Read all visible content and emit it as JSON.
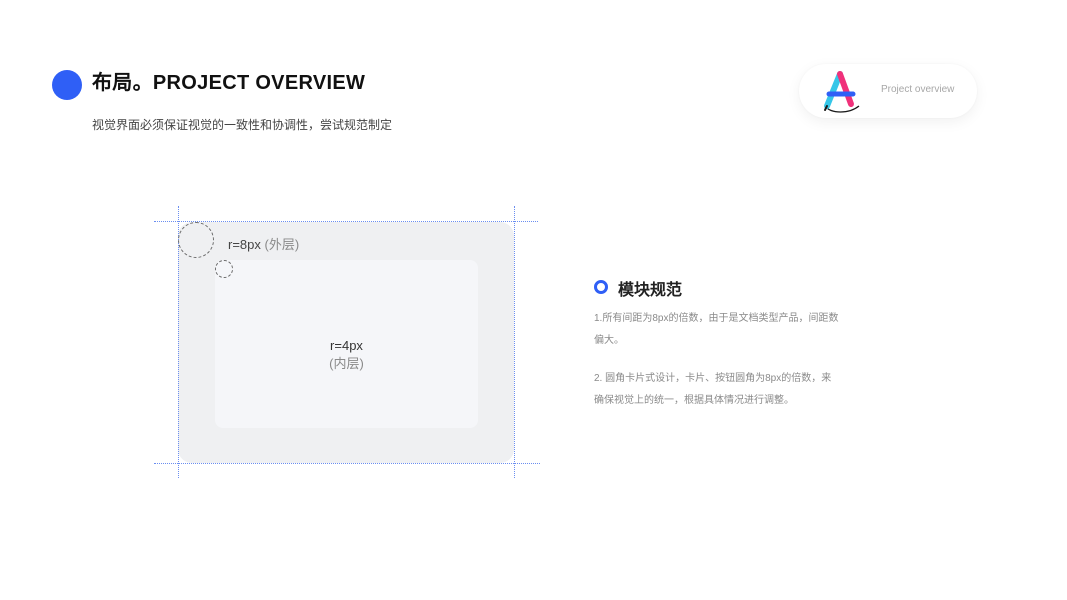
{
  "header": {
    "title": "布局。PROJECT OVERVIEW",
    "subtitle": "视觉界面必须保证视觉的一致性和协调性，尝试规范制定"
  },
  "badge": {
    "label": "Project overview",
    "logo_colors": [
      "#2f5ff6",
      "#f0317a",
      "#35c6e8"
    ]
  },
  "diagram": {
    "outer_label": "r=8px",
    "outer_note": "(外层)",
    "inner_label": "r=4px",
    "inner_note": "(内层)"
  },
  "section": {
    "title": "模块规范",
    "para1": "1.所有间距为8px的倍数，由于是文档类型产品，间距数偏大。",
    "para2": "2. 圆角卡片式设计，卡片、按钮圆角为8px的倍数，来确保视觉上的统一，根据具体情况进行调整。"
  },
  "colors": {
    "accent": "#2f5ff6",
    "guide": "#6b8ef0",
    "outer_bg": "#eff0f2",
    "inner_bg": "#f5f6f9"
  }
}
